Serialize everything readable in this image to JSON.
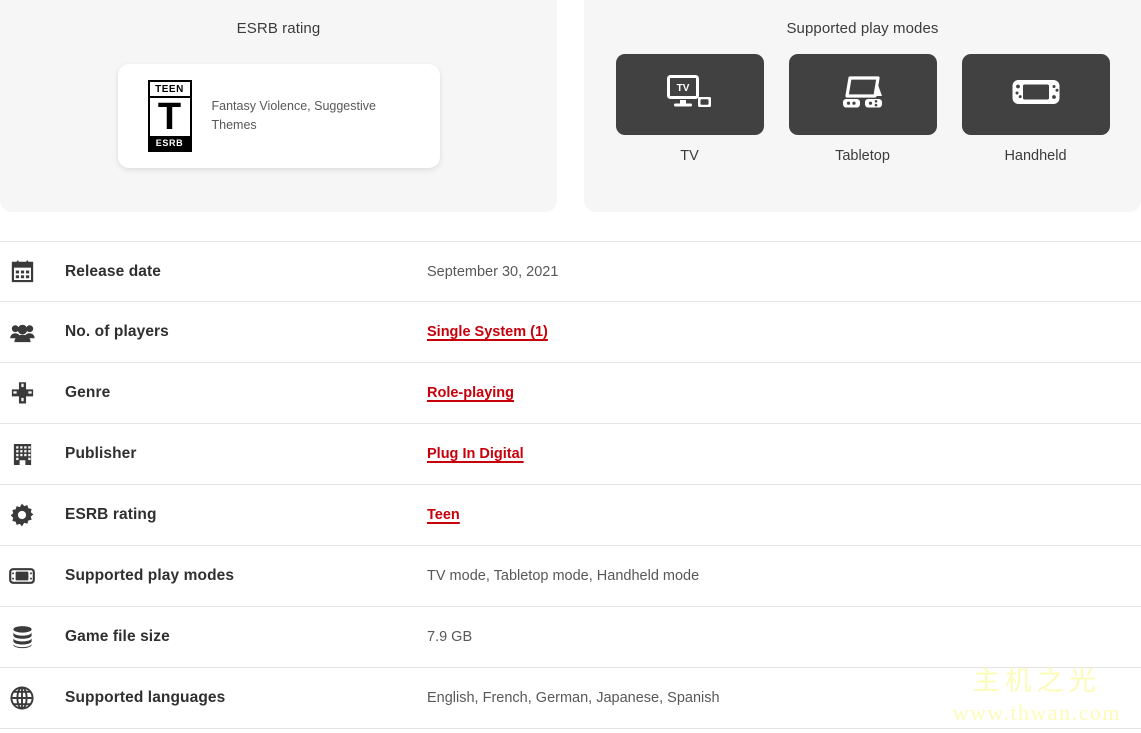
{
  "esrb_panel": {
    "title": "ESRB rating",
    "logo": {
      "top_text": "TEEN",
      "letter": "T",
      "bottom_text": "ESRB",
      "icon": "esrb-teen-logo"
    },
    "descriptors": "Fantasy Violence, Suggestive Themes"
  },
  "play_modes_panel": {
    "title": "Supported play modes",
    "modes": [
      {
        "label": "TV",
        "icon": "tv-mode-icon"
      },
      {
        "label": "Tabletop",
        "icon": "tabletop-mode-icon"
      },
      {
        "label": "Handheld",
        "icon": "handheld-mode-icon"
      }
    ]
  },
  "details": {
    "rows": [
      {
        "icon": "calendar-icon",
        "label": "Release date",
        "value": "September 30, 2021",
        "is_link": false
      },
      {
        "icon": "players-icon",
        "label": "No. of players",
        "value": "Single System (1)",
        "is_link": true
      },
      {
        "icon": "dpad-icon",
        "label": "Genre",
        "value": "Role-playing",
        "is_link": true
      },
      {
        "icon": "building-icon",
        "label": "Publisher",
        "value": "Plug In Digital",
        "is_link": true
      },
      {
        "icon": "gear-icon",
        "label": "ESRB rating",
        "value": "Teen",
        "is_link": true
      },
      {
        "icon": "console-icon",
        "label": "Supported play modes",
        "value": "TV mode, Tabletop mode, Handheld mode",
        "is_link": false
      },
      {
        "icon": "database-icon",
        "label": "Game file size",
        "value": "7.9 GB",
        "is_link": false
      },
      {
        "icon": "globe-icon",
        "label": "Supported languages",
        "value": "English, French, German, Japanese, Spanish",
        "is_link": false
      }
    ]
  },
  "watermark": {
    "chinese": "主机之光",
    "url": "www.thwan.com"
  },
  "colors": {
    "link_red": "#c7000b",
    "panel_bg": "#f6f6f6",
    "tile_bg": "#414141",
    "watermark": "#fdfbb8"
  }
}
